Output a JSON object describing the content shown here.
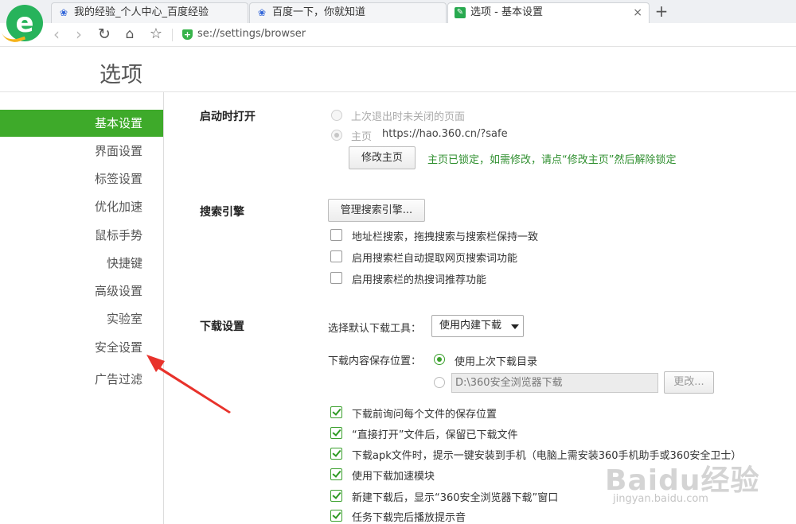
{
  "browser": {
    "tabs": [
      {
        "label": "我的经验_个人中心_百度经验",
        "icon": "baidu-paw-icon"
      },
      {
        "label": "百度一下，你就知道",
        "icon": "baidu-paw-icon"
      },
      {
        "label": "选项 - 基本设置",
        "icon": "settings-page-icon"
      }
    ],
    "new_tab": "+",
    "tab_close": "×",
    "url": "se://settings/browser"
  },
  "page": {
    "title": "选项"
  },
  "sidebar": {
    "items": [
      {
        "label": "基本设置",
        "active": true
      },
      {
        "label": "界面设置"
      },
      {
        "label": "标签设置"
      },
      {
        "label": "优化加速"
      },
      {
        "label": "鼠标手势"
      },
      {
        "label": "快捷键"
      },
      {
        "label": "高级设置"
      },
      {
        "label": "实验室"
      },
      {
        "label": "安全设置"
      },
      {
        "label": "广告过滤"
      }
    ]
  },
  "startup": {
    "heading": "启动时打开",
    "opt_last": "上次退出时未关闭的页面",
    "opt_home_label": "主页",
    "home_url": "https://hao.360.cn/?safe",
    "modify_btn": "修改主页",
    "lock_tip": "主页已锁定，如需修改，请点“修改主页”然后解除锁定"
  },
  "search": {
    "heading": "搜索引擎",
    "manage_btn": "管理搜索引擎...",
    "checks": [
      {
        "label": "地址栏搜索，拖拽搜索与搜索栏保持一致",
        "checked": false
      },
      {
        "label": "启用搜索栏自动提取网页搜索词功能",
        "checked": false
      },
      {
        "label": "启用搜索栏的热搜词推荐功能",
        "checked": false
      }
    ]
  },
  "download": {
    "heading": "下载设置",
    "tool_label": "选择默认下载工具：",
    "tool_value": "使用内建下载",
    "save_label": "下载内容保存位置：",
    "use_last_dir": "使用上次下载目录",
    "path": "D:\\360安全浏览器下载",
    "change_btn": "更改...",
    "checks": [
      {
        "label": "下载前询问每个文件的保存位置",
        "checked": true
      },
      {
        "label": "“直接打开”文件后，保留已下载文件",
        "checked": true
      },
      {
        "label": "下载apk文件时，提示一键安装到手机（电脑上需安装360手机助手或360安全卫士）",
        "checked": true
      },
      {
        "label": "使用下载加速模块",
        "checked": true
      },
      {
        "label": "新建下载后，显示“360安全浏览器下载”窗口",
        "checked": true
      },
      {
        "label": "任务下载完后播放提示音",
        "checked": true
      }
    ]
  },
  "watermark": {
    "brand": "Baidu经验",
    "site": "jingyan.baidu.com"
  },
  "colors": {
    "accent": "#3eaa2a",
    "lock_tip": "#2f8f2f",
    "arrow": "#e8322b"
  }
}
